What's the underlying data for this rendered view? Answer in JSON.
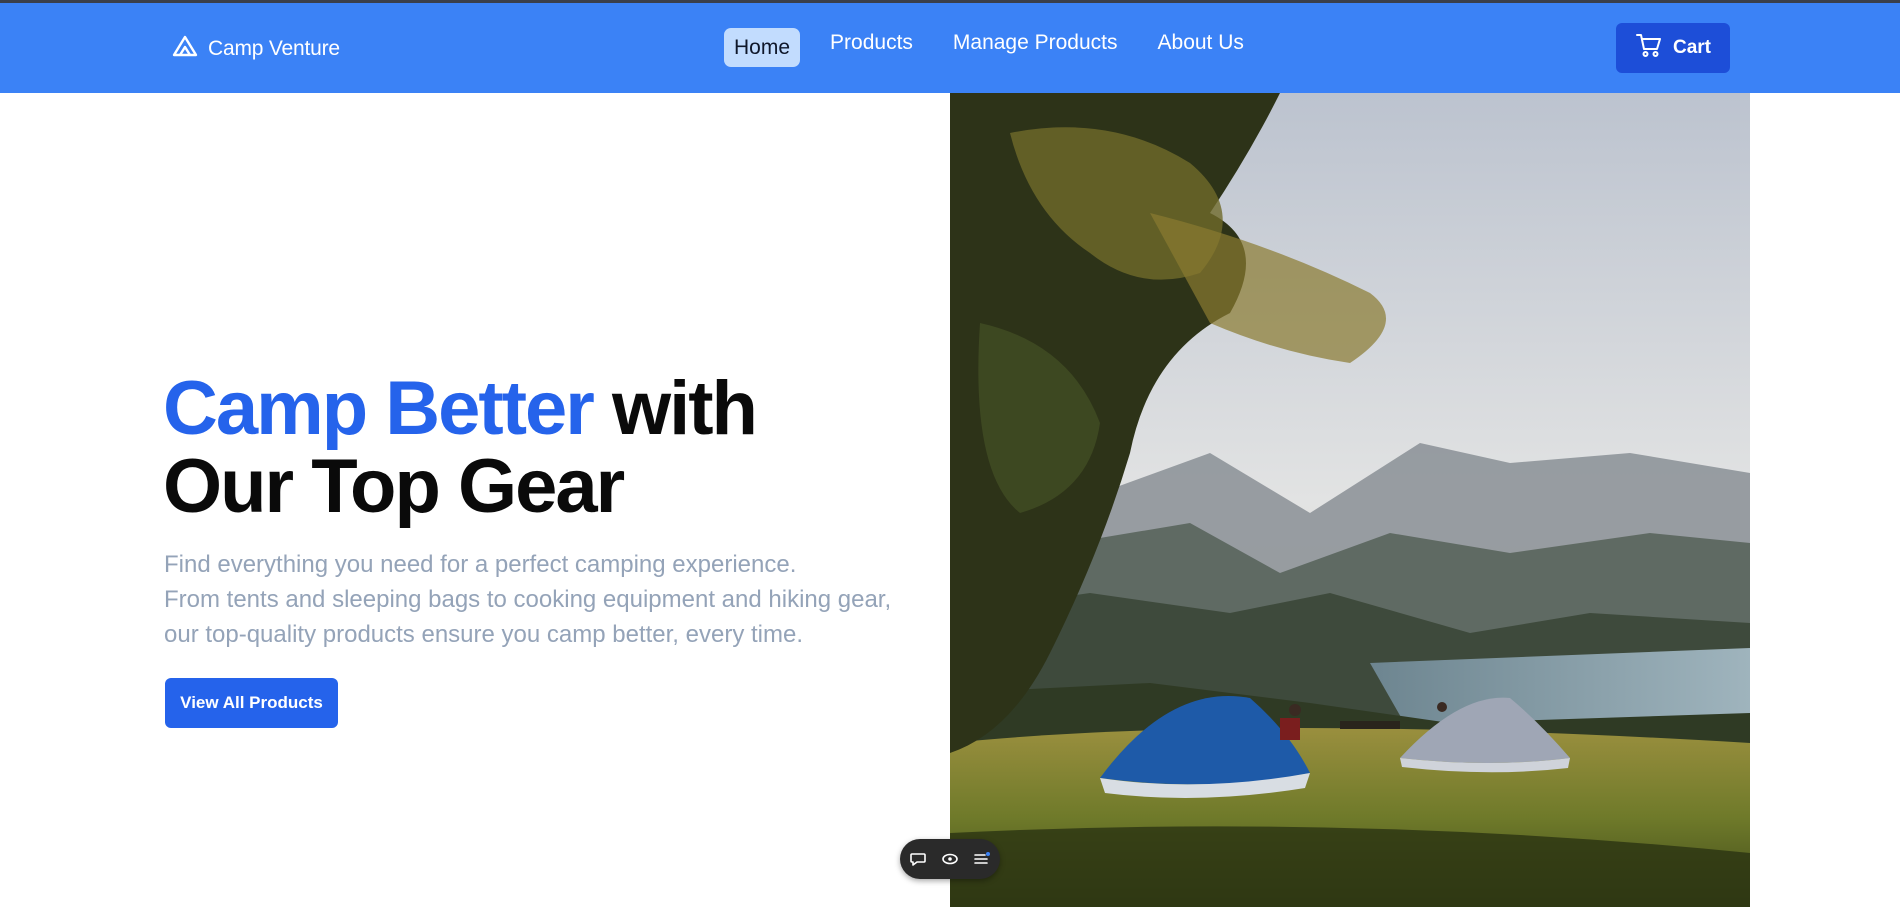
{
  "brand": {
    "name": "Camp Venture",
    "logo_icon": "mountain-icon"
  },
  "nav": {
    "links": [
      {
        "label": "Home",
        "active": true
      },
      {
        "label": "Products",
        "active": false
      },
      {
        "label": "Manage Products",
        "active": false
      },
      {
        "label": "About Us",
        "active": false
      }
    ],
    "cart_label": "Cart",
    "cart_icon": "cart-icon"
  },
  "hero": {
    "title_accent": "Camp Better",
    "title_rest_line1": " with",
    "title_line2": "Our Top Gear",
    "description_lines": [
      "Find everything you need for a perfect camping experience.",
      "From tents and sleeping bags to cooking equipment and hiking gear,",
      "our top-quality products ensure you camp better, every time."
    ],
    "cta_label": "View All Products",
    "image_subject": "camping tents on a grassy hilltop overlooking a lake and mountains"
  },
  "floating_toolbar": {
    "icons": [
      "chat-bubble-icon",
      "eye-icon",
      "menu-list-icon"
    ]
  },
  "colors": {
    "navbar": "#3b82f6",
    "accent": "#2563eb",
    "cart_button": "#1d4ed8",
    "active_nav_bg": "#c2dcfe",
    "description_text": "#94a3b8"
  }
}
